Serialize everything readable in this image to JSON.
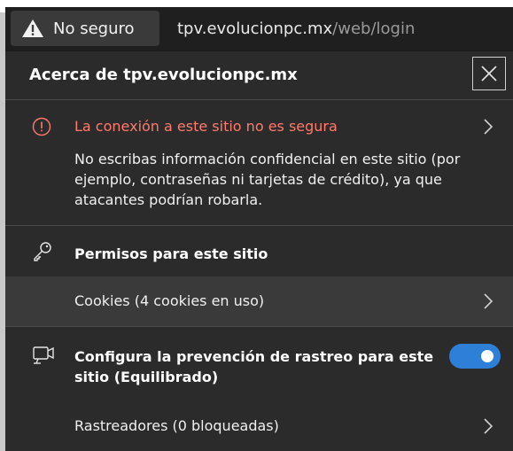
{
  "address_bar": {
    "security_label": "No seguro",
    "url_host": "tpv.evolucionpc.mx",
    "url_path": "/web/login",
    "security_icon": "warning-triangle-icon"
  },
  "panel": {
    "title": "Acerca de tpv.evolucionpc.mx",
    "close_icon": "close-icon",
    "connection": {
      "title": "La conexión a este sitio no es segura",
      "description": "No escribas información confidencial en este sitio (por ejemplo, contraseñas ni tarjetas de crédito), ya que atacantes podrían robarla.",
      "title_color": "#ff7a6b"
    },
    "permissions": {
      "title": "Permisos para este sitio",
      "cookies_label": "Cookies (4 cookies en uso)"
    },
    "tracking": {
      "title": "Configura la prevención de rastreo para este sitio (Equilibrado)",
      "toggle_on": true,
      "toggle_color": "#2d7fd8",
      "trackers_label": "Rastreadores (0 bloqueadas)"
    }
  }
}
